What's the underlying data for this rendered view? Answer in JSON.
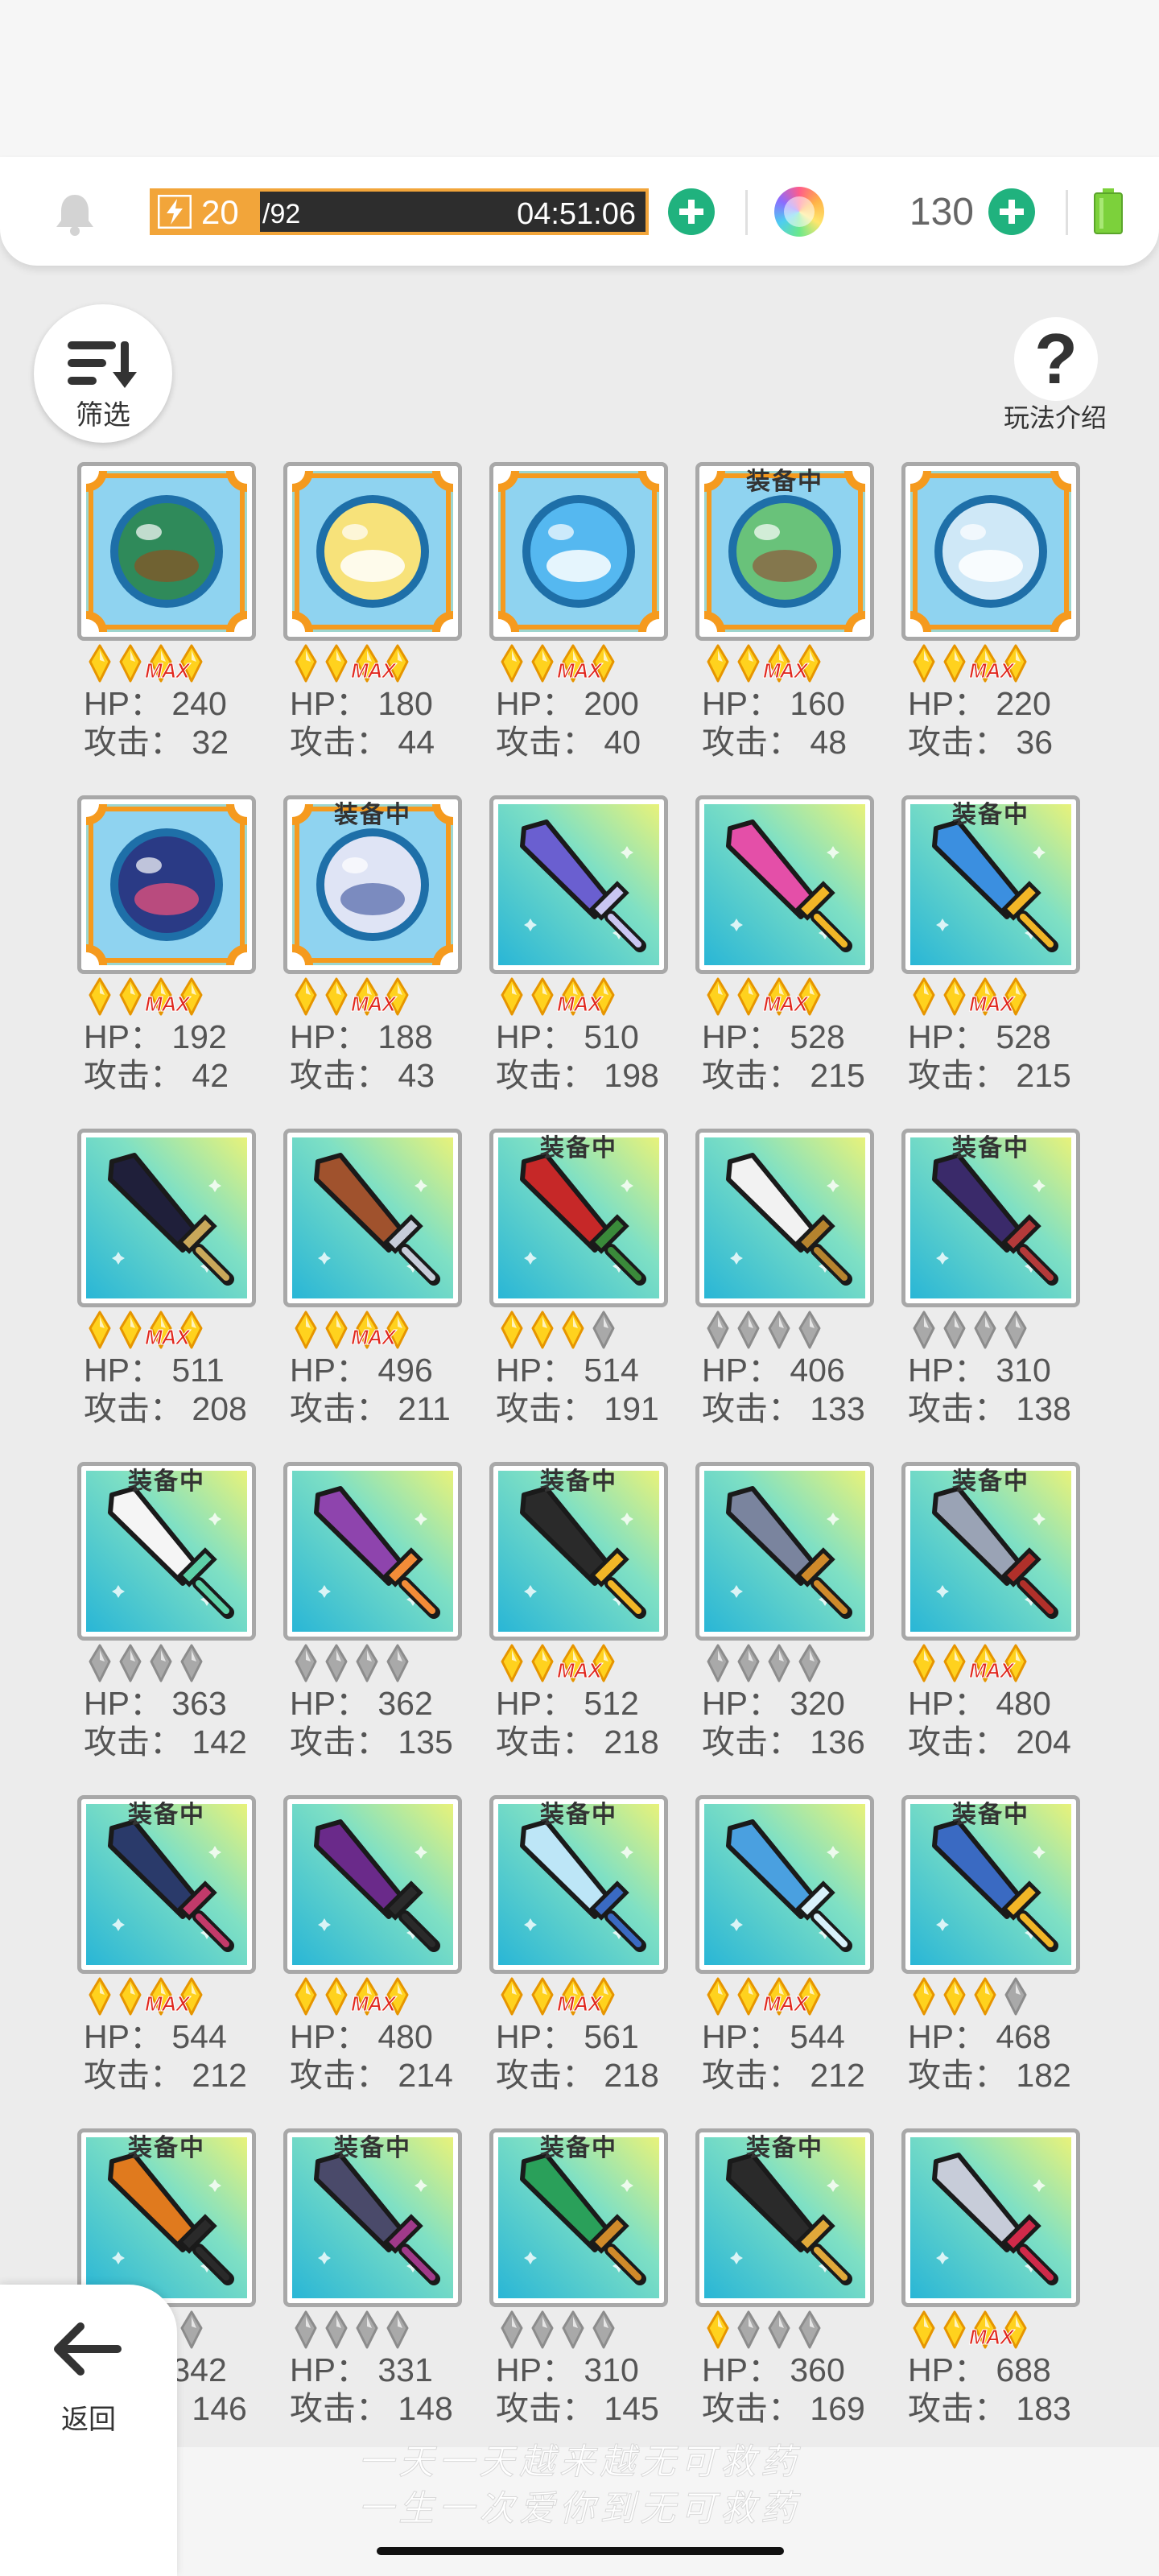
{
  "topbar": {
    "energy_current": "20",
    "energy_max": "/92",
    "energy_fraction": 0.217,
    "energy_timer": "04:51:06",
    "gems": "130",
    "energy_color": "#f2a53a",
    "plus_color": "#20b27e",
    "battery_color": "#7cd13b"
  },
  "filter_label": "筛选",
  "help_label": "玩法介绍",
  "help_glyph": "?",
  "back_label": "返回",
  "hp_prefix": "HP：",
  "atk_prefix": "攻击：",
  "equipped_label": "装备中",
  "watermark": [
    "一天一天越来越无可救药",
    "一生一次爱你到无可救药"
  ],
  "items": [
    {
      "kind": "orb",
      "art": "orb-green",
      "equipped": false,
      "stars": "gold",
      "max": true,
      "hp": "240",
      "atk": "32"
    },
    {
      "kind": "orb",
      "art": "orb-yellow",
      "equipped": false,
      "stars": "gold",
      "max": true,
      "hp": "180",
      "atk": "44"
    },
    {
      "kind": "orb",
      "art": "orb-blue",
      "equipped": false,
      "stars": "gold",
      "max": true,
      "hp": "200",
      "atk": "40"
    },
    {
      "kind": "orb",
      "art": "orb-earth",
      "equipped": true,
      "stars": "gold",
      "max": true,
      "hp": "160",
      "atk": "48"
    },
    {
      "kind": "orb",
      "art": "orb-ice",
      "equipped": false,
      "stars": "gold",
      "max": true,
      "hp": "220",
      "atk": "36"
    },
    {
      "kind": "orb",
      "art": "orb-night",
      "equipped": false,
      "stars": "gold",
      "max": true,
      "hp": "192",
      "atk": "42"
    },
    {
      "kind": "orb",
      "art": "orb-silver",
      "equipped": true,
      "stars": "gold",
      "max": true,
      "hp": "188",
      "atk": "43"
    },
    {
      "kind": "weapon",
      "art": "sword-purple",
      "equipped": false,
      "stars": "gold",
      "max": true,
      "hp": "510",
      "atk": "198"
    },
    {
      "kind": "weapon",
      "art": "sword-rainbow",
      "equipped": false,
      "stars": "gold",
      "max": true,
      "hp": "528",
      "atk": "215"
    },
    {
      "kind": "weapon",
      "art": "sword-blue",
      "equipped": true,
      "stars": "gold",
      "max": true,
      "hp": "528",
      "atk": "215"
    },
    {
      "kind": "weapon",
      "art": "scythe-dark",
      "equipped": false,
      "stars": "gold",
      "max": true,
      "hp": "511",
      "atk": "208"
    },
    {
      "kind": "weapon",
      "art": "crossed-axes",
      "equipped": false,
      "stars": "gold",
      "max": true,
      "hp": "496",
      "atk": "211"
    },
    {
      "kind": "weapon",
      "art": "cleaver-red",
      "equipped": true,
      "stars": "three-gold",
      "max": false,
      "hp": "514",
      "atk": "191"
    },
    {
      "kind": "weapon",
      "art": "sword-white",
      "equipped": false,
      "stars": "gray",
      "max": false,
      "hp": "406",
      "atk": "133"
    },
    {
      "kind": "weapon",
      "art": "sword-void",
      "equipped": true,
      "stars": "gray",
      "max": false,
      "hp": "310",
      "atk": "138"
    },
    {
      "kind": "weapon",
      "art": "fan-green",
      "equipped": true,
      "stars": "gray",
      "max": false,
      "hp": "363",
      "atk": "142"
    },
    {
      "kind": "weapon",
      "art": "whip-purple",
      "equipped": false,
      "stars": "gray",
      "max": false,
      "hp": "362",
      "atk": "135"
    },
    {
      "kind": "weapon",
      "art": "hammer-gold",
      "equipped": true,
      "stars": "gold",
      "max": true,
      "hp": "512",
      "atk": "218"
    },
    {
      "kind": "weapon",
      "art": "pickaxe-steel",
      "equipped": false,
      "stars": "gray",
      "max": false,
      "hp": "320",
      "atk": "136"
    },
    {
      "kind": "weapon",
      "art": "axe-gray",
      "equipped": true,
      "stars": "gold",
      "max": true,
      "hp": "480",
      "atk": "204"
    },
    {
      "kind": "weapon",
      "art": "axe-dark",
      "equipped": true,
      "stars": "gold",
      "max": true,
      "hp": "544",
      "atk": "212"
    },
    {
      "kind": "weapon",
      "art": "scythe-purple",
      "equipped": false,
      "stars": "gold",
      "max": true,
      "hp": "480",
      "atk": "214"
    },
    {
      "kind": "weapon",
      "art": "spear-ice",
      "equipped": true,
      "stars": "gold",
      "max": true,
      "hp": "561",
      "atk": "218"
    },
    {
      "kind": "weapon",
      "art": "spear-blue",
      "equipped": false,
      "stars": "gold",
      "max": true,
      "hp": "544",
      "atk": "212"
    },
    {
      "kind": "weapon",
      "art": "trident-blue",
      "equipped": true,
      "stars": "three-gold",
      "max": false,
      "hp": "468",
      "atk": "182"
    },
    {
      "kind": "weapon",
      "art": "hammer-orange",
      "equipped": true,
      "stars": "gray",
      "max": false,
      "hp": "342",
      "atk": "146"
    },
    {
      "kind": "weapon",
      "art": "mace-dark",
      "equipped": true,
      "stars": "gray",
      "max": false,
      "hp": "331",
      "atk": "148"
    },
    {
      "kind": "weapon",
      "art": "spear-green",
      "equipped": true,
      "stars": "gray",
      "max": false,
      "hp": "310",
      "atk": "145"
    },
    {
      "kind": "weapon",
      "art": "staff-black",
      "equipped": true,
      "stars": "one-gold",
      "max": false,
      "hp": "360",
      "atk": "169"
    },
    {
      "kind": "weapon",
      "art": "bow-silver",
      "equipped": false,
      "stars": "gold",
      "max": true,
      "hp": "688",
      "atk": "183"
    }
  ]
}
